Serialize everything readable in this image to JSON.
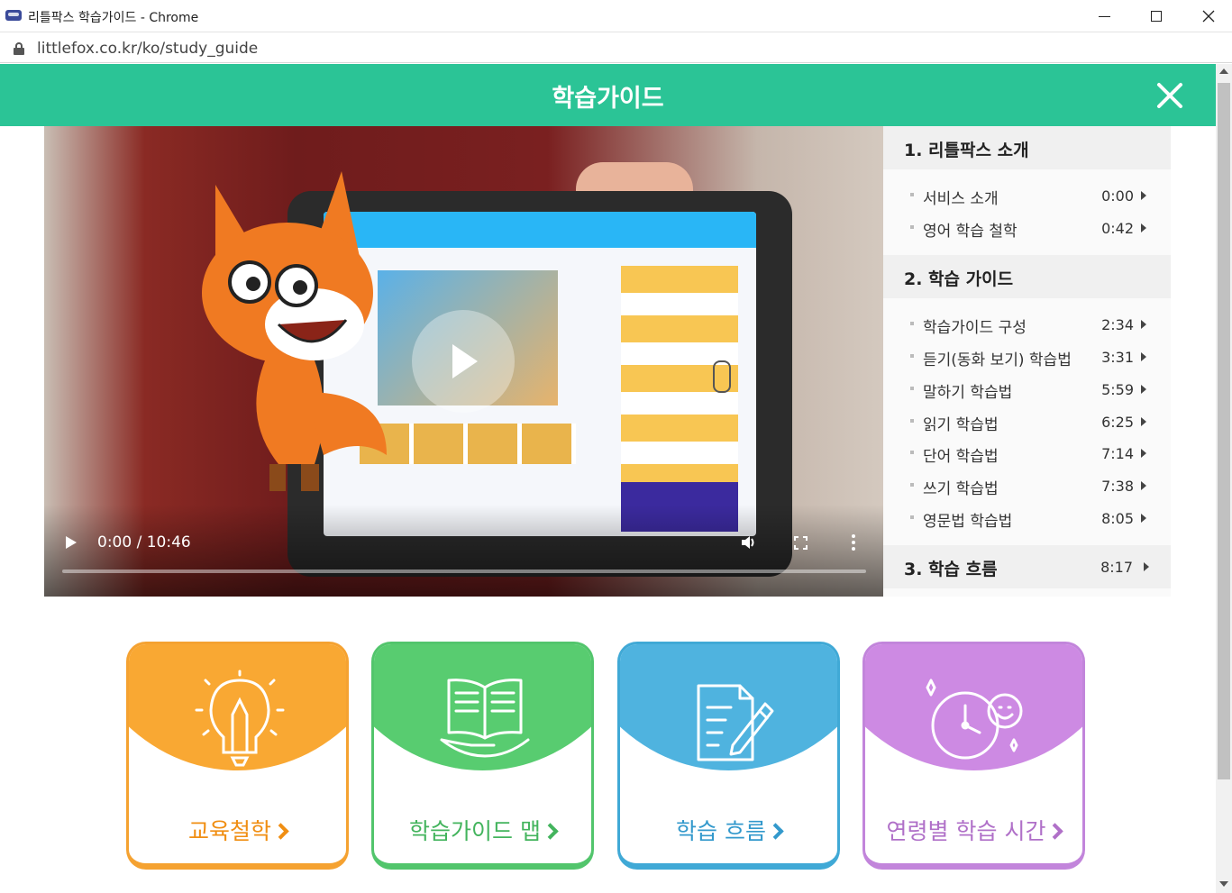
{
  "window": {
    "title": "리틀팍스 학습가이드 - Chrome",
    "url": "littlefox.co.kr/ko/study_guide"
  },
  "header": {
    "title": "학습가이드"
  },
  "video": {
    "time": "0:00 / 10:46",
    "progress": 0
  },
  "chapters": [
    {
      "title": "1. 리틀팍스 소개",
      "items": [
        {
          "label": "서비스 소개",
          "time": "0:00"
        },
        {
          "label": "영어 학습 철학",
          "time": "0:42"
        }
      ]
    },
    {
      "title": "2. 학습 가이드",
      "items": [
        {
          "label": "학습가이드 구성",
          "time": "2:34"
        },
        {
          "label": "듣기(동화 보기) 학습법",
          "time": "3:31"
        },
        {
          "label": "말하기 학습법",
          "time": "5:59"
        },
        {
          "label": "읽기 학습법",
          "time": "6:25"
        },
        {
          "label": "단어 학습법",
          "time": "7:14"
        },
        {
          "label": "쓰기 학습법",
          "time": "7:38"
        },
        {
          "label": "영문법 학습법",
          "time": "8:05"
        }
      ]
    },
    {
      "title": "3. 학습 흐름",
      "time": "8:17"
    }
  ],
  "cards": [
    {
      "label": "교육철학",
      "icon": "lightbulb-pencil-icon",
      "color": "#f9a833"
    },
    {
      "label": "학습가이드 맵",
      "icon": "open-book-hand-icon",
      "color": "#58cc70"
    },
    {
      "label": "학습 흐름",
      "icon": "document-pen-icon",
      "color": "#4fb3df"
    },
    {
      "label": "연령별 학습 시간",
      "icon": "clock-face-icon",
      "color": "#cd8ae3"
    }
  ],
  "colors": {
    "header": "#2bc496"
  }
}
